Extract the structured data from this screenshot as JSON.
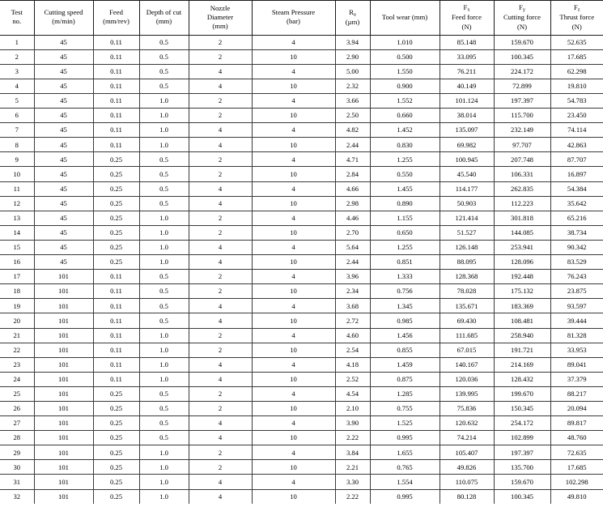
{
  "table": {
    "name": "machining-experiment-results",
    "columns": [
      {
        "id": "test_no",
        "line1": "Test",
        "line2": "no.",
        "line3": ""
      },
      {
        "id": "cutting_speed",
        "line1": "Cutting speed",
        "line2": "(m/min)",
        "line3": ""
      },
      {
        "id": "feed",
        "line1": "Feed",
        "line2": "(mm/rev)",
        "line3": ""
      },
      {
        "id": "depth_of_cut",
        "line1": "Depth of cut",
        "line2": "(mm)",
        "line3": ""
      },
      {
        "id": "nozzle_dia",
        "line1": "Nozzle",
        "line2": "Diameter",
        "line3": "(mm)"
      },
      {
        "id": "steam_pressure",
        "line1": "Steam Pressure",
        "line2": "(bar)",
        "line3": ""
      },
      {
        "id": "ra",
        "line1": "R",
        "sub1": "a",
        "line2": "(µm)",
        "line3": ""
      },
      {
        "id": "tool_wear",
        "line1": "Tool wear (mm)",
        "line2": "",
        "line3": ""
      },
      {
        "id": "fx",
        "line1": "F",
        "sub1": "x",
        "line2": "Feed force",
        "line3": "(N)"
      },
      {
        "id": "fy",
        "line1": "F",
        "sub1": "y",
        "line2": "Cutting force",
        "line3": "(N)"
      },
      {
        "id": "fz",
        "line1": "F",
        "sub1": "z",
        "line2": "Thrust force",
        "line3": "(N)"
      }
    ],
    "rows": [
      [
        "1",
        "45",
        "0.11",
        "0.5",
        "2",
        "4",
        "3.94",
        "1.010",
        "85.148",
        "159.670",
        "52.635"
      ],
      [
        "2",
        "45",
        "0.11",
        "0.5",
        "2",
        "10",
        "2.90",
        "0.500",
        "33.095",
        "100.345",
        "17.685"
      ],
      [
        "3",
        "45",
        "0.11",
        "0.5",
        "4",
        "4",
        "5.00",
        "1.550",
        "76.211",
        "224.172",
        "62.298"
      ],
      [
        "4",
        "45",
        "0.11",
        "0.5",
        "4",
        "10",
        "2.32",
        "0.900",
        "40.149",
        "72.899",
        "19.810"
      ],
      [
        "5",
        "45",
        "0.11",
        "1.0",
        "2",
        "4",
        "3.66",
        "1.552",
        "101.124",
        "197.397",
        "54.783"
      ],
      [
        "6",
        "45",
        "0.11",
        "1.0",
        "2",
        "10",
        "2.50",
        "0.660",
        "38.014",
        "115.700",
        "23.450"
      ],
      [
        "7",
        "45",
        "0.11",
        "1.0",
        "4",
        "4",
        "4.82",
        "1.452",
        "135.097",
        "232.149",
        "74.114"
      ],
      [
        "8",
        "45",
        "0.11",
        "1.0",
        "4",
        "10",
        "2.44",
        "0.830",
        "69.982",
        "97.707",
        "42.863"
      ],
      [
        "9",
        "45",
        "0.25",
        "0.5",
        "2",
        "4",
        "4.71",
        "1.255",
        "100.945",
        "207.748",
        "87.707"
      ],
      [
        "10",
        "45",
        "0.25",
        "0.5",
        "2",
        "10",
        "2.84",
        "0.550",
        "45.540",
        "106.331",
        "16.897"
      ],
      [
        "11",
        "45",
        "0.25",
        "0.5",
        "4",
        "4",
        "4.66",
        "1.455",
        "114.177",
        "262.835",
        "54.384"
      ],
      [
        "12",
        "45",
        "0.25",
        "0.5",
        "4",
        "10",
        "2.98",
        "0.890",
        "50.903",
        "112.223",
        "35.642"
      ],
      [
        "13",
        "45",
        "0.25",
        "1.0",
        "2",
        "4",
        "4.46",
        "1.155",
        "121.414",
        "301.818",
        "65.216"
      ],
      [
        "14",
        "45",
        "0.25",
        "1.0",
        "2",
        "10",
        "2.70",
        "0.650",
        "51.527",
        "144.085",
        "38.734"
      ],
      [
        "15",
        "45",
        "0.25",
        "1.0",
        "4",
        "4",
        "5.64",
        "1.255",
        "126.148",
        "253.941",
        "90.342"
      ],
      [
        "16",
        "45",
        "0.25",
        "1.0",
        "4",
        "10",
        "2.44",
        "0.851",
        "88.095",
        "128.096",
        "83.529"
      ],
      [
        "17",
        "101",
        "0.11",
        "0.5",
        "2",
        "4",
        "3.96",
        "1.333",
        "128.368",
        "192.448",
        "76.243"
      ],
      [
        "18",
        "101",
        "0.11",
        "0.5",
        "2",
        "10",
        "2.34",
        "0.756",
        "78.028",
        "175.132",
        "23.875"
      ],
      [
        "19",
        "101",
        "0.11",
        "0.5",
        "4",
        "4",
        "3.68",
        "1.345",
        "135.671",
        "183.369",
        "93.597"
      ],
      [
        "20",
        "101",
        "0.11",
        "0.5",
        "4",
        "10",
        "2.72",
        "0.985",
        "69.430",
        "108.481",
        "39.444"
      ],
      [
        "21",
        "101",
        "0.11",
        "1.0",
        "2",
        "4",
        "4.60",
        "1.456",
        "111.685",
        "258.940",
        "81.328"
      ],
      [
        "22",
        "101",
        "0.11",
        "1.0",
        "2",
        "10",
        "2.54",
        "0.855",
        "67.015",
        "191.721",
        "33.953"
      ],
      [
        "23",
        "101",
        "0.11",
        "1.0",
        "4",
        "4",
        "4.18",
        "1.459",
        "140.167",
        "214.169",
        "89.041"
      ],
      [
        "24",
        "101",
        "0.11",
        "1.0",
        "4",
        "10",
        "2.52",
        "0.875",
        "120.036",
        "128.432",
        "37.379"
      ],
      [
        "25",
        "101",
        "0.25",
        "0.5",
        "2",
        "4",
        "4.54",
        "1.285",
        "139.995",
        "199.670",
        "88.217"
      ],
      [
        "26",
        "101",
        "0.25",
        "0.5",
        "2",
        "10",
        "2.10",
        "0.755",
        "75.836",
        "150.345",
        "20.094"
      ],
      [
        "27",
        "101",
        "0.25",
        "0.5",
        "4",
        "4",
        "3.90",
        "1.525",
        "120.632",
        "254.172",
        "89.817"
      ],
      [
        "28",
        "101",
        "0.25",
        "0.5",
        "4",
        "10",
        "2.22",
        "0.995",
        "74.214",
        "102.899",
        "48.760"
      ],
      [
        "29",
        "101",
        "0.25",
        "1.0",
        "2",
        "4",
        "3.84",
        "1.655",
        "105.407",
        "197.397",
        "72.635"
      ],
      [
        "30",
        "101",
        "0.25",
        "1.0",
        "2",
        "10",
        "2.21",
        "0.765",
        "49.826",
        "135.700",
        "17.685"
      ],
      [
        "31",
        "101",
        "0.25",
        "1.0",
        "4",
        "4",
        "3.30",
        "1.554",
        "110.075",
        "159.670",
        "102.298"
      ],
      [
        "32",
        "101",
        "0.25",
        "1.0",
        "4",
        "10",
        "2.22",
        "0.995",
        "80.128",
        "100.345",
        "49.810"
      ]
    ]
  }
}
